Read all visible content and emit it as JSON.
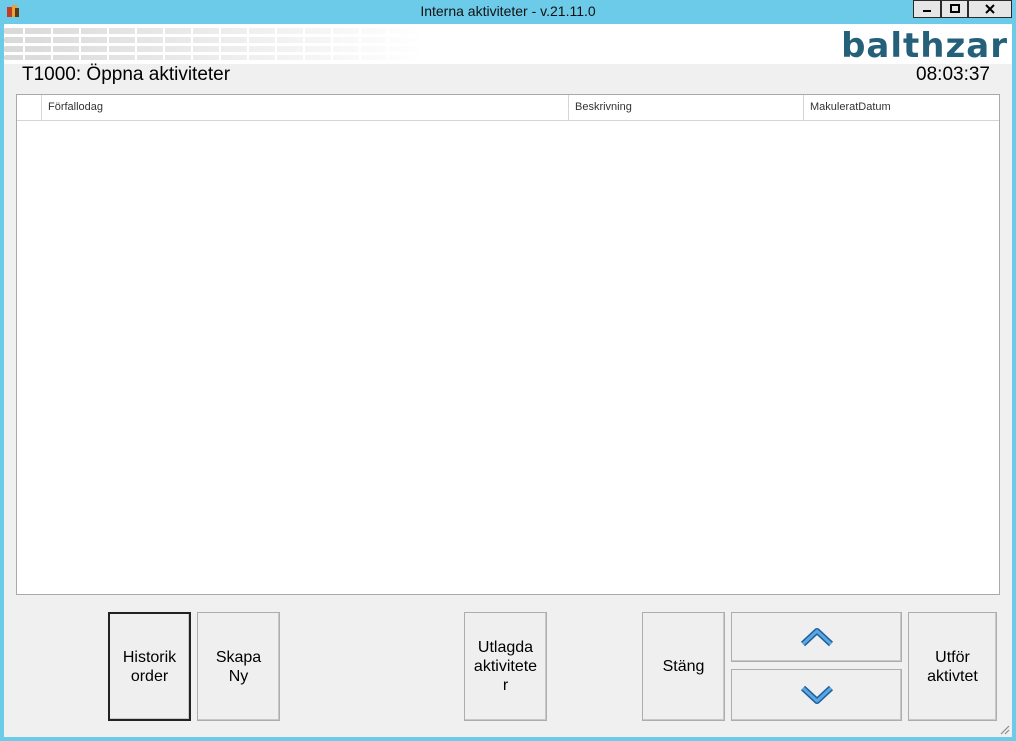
{
  "window": {
    "title": "Interna aktiviteter - v.21.11.0",
    "controls": {
      "minimize": "▁",
      "maximize": "□",
      "close": "✕"
    }
  },
  "header": {
    "logo": "balthzar",
    "page_title": "T1000: Öppna aktiviteter",
    "clock": "08:03:37"
  },
  "grid": {
    "columns": [
      "Förfallodag",
      "Beskrivning",
      "MakuleratDatum"
    ],
    "rows": []
  },
  "buttons": {
    "history": "Historik\norder",
    "create_new": "Skapa\nNy",
    "assigned": "Utlagda\naktivitete\nr",
    "close": "Stäng",
    "perform": "Utför\naktivtet"
  },
  "icons": {
    "up": "chevron-up-icon",
    "down": "chevron-down-icon"
  },
  "colors": {
    "titlebar": "#6ccbe9",
    "logo": "#24607a",
    "arrow": "#3b82c4"
  }
}
